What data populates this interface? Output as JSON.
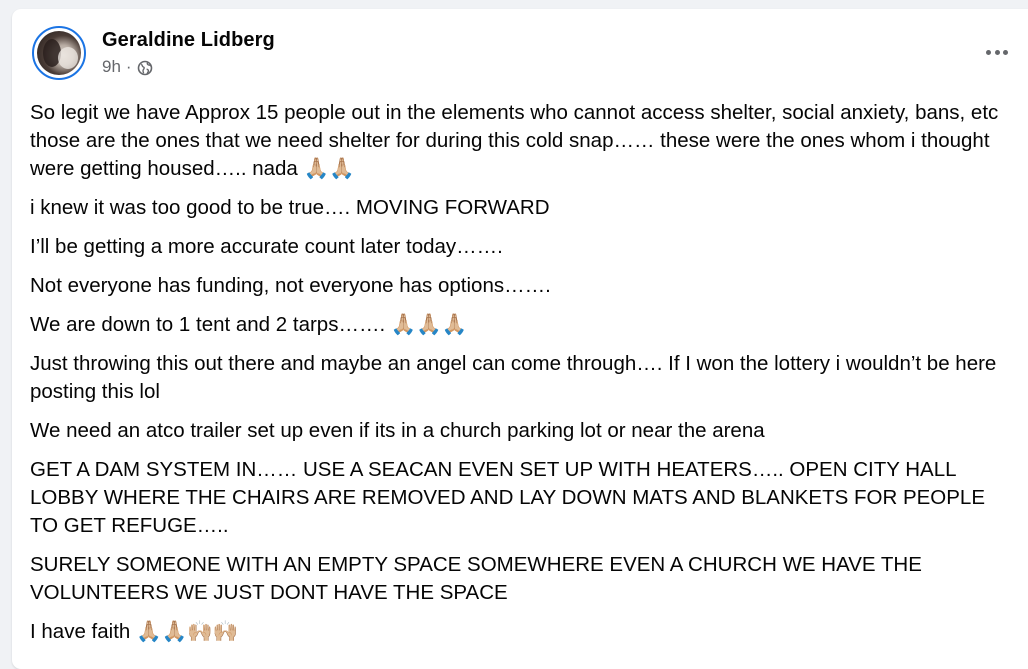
{
  "post": {
    "author": "Geraldine Lidberg",
    "timestamp": "9h",
    "separator": "·",
    "audience_icon": "globe-icon",
    "more_icon": "more-options-icon",
    "paragraphs": [
      "So legit we have Approx 15 people out in the elements who cannot access shelter, social anxiety, bans, etc those are the ones that we need shelter for during this cold snap…… these were the ones whom i thought were getting housed….. nada 🙏🏼🙏🏼",
      "i knew it was too good to be true…. MOVING FORWARD",
      "I’ll be getting a more accurate count later today…….",
      "Not everyone has funding, not everyone has options…….",
      "We are down to 1 tent and 2 tarps……. 🙏🏼🙏🏼🙏🏼",
      "Just throwing this out there and maybe an angel can come through…. If I won the lottery i wouldn’t be here posting this lol",
      "We need an atco trailer set up even if its in a church parking lot or near the arena",
      "GET A DAM SYSTEM IN…… USE A SEACAN EVEN SET UP WITH HEATERS….. OPEN CITY HALL LOBBY WHERE THE CHAIRS ARE REMOVED AND LAY DOWN MATS AND BLANKETS FOR PEOPLE TO GET REFUGE…..",
      "SURELY SOMEONE WITH AN EMPTY SPACE SOMEWHERE EVEN A CHURCH WE HAVE THE VOLUNTEERS WE JUST DONT HAVE THE SPACE",
      "I have faith 🙏🏼🙏🏼🙌🏼🙌🏼"
    ]
  },
  "colors": {
    "name": "#050505",
    "meta": "#65676b",
    "story_ring": "#1b74e4",
    "background": "#f0f2f5",
    "card": "#ffffff"
  }
}
